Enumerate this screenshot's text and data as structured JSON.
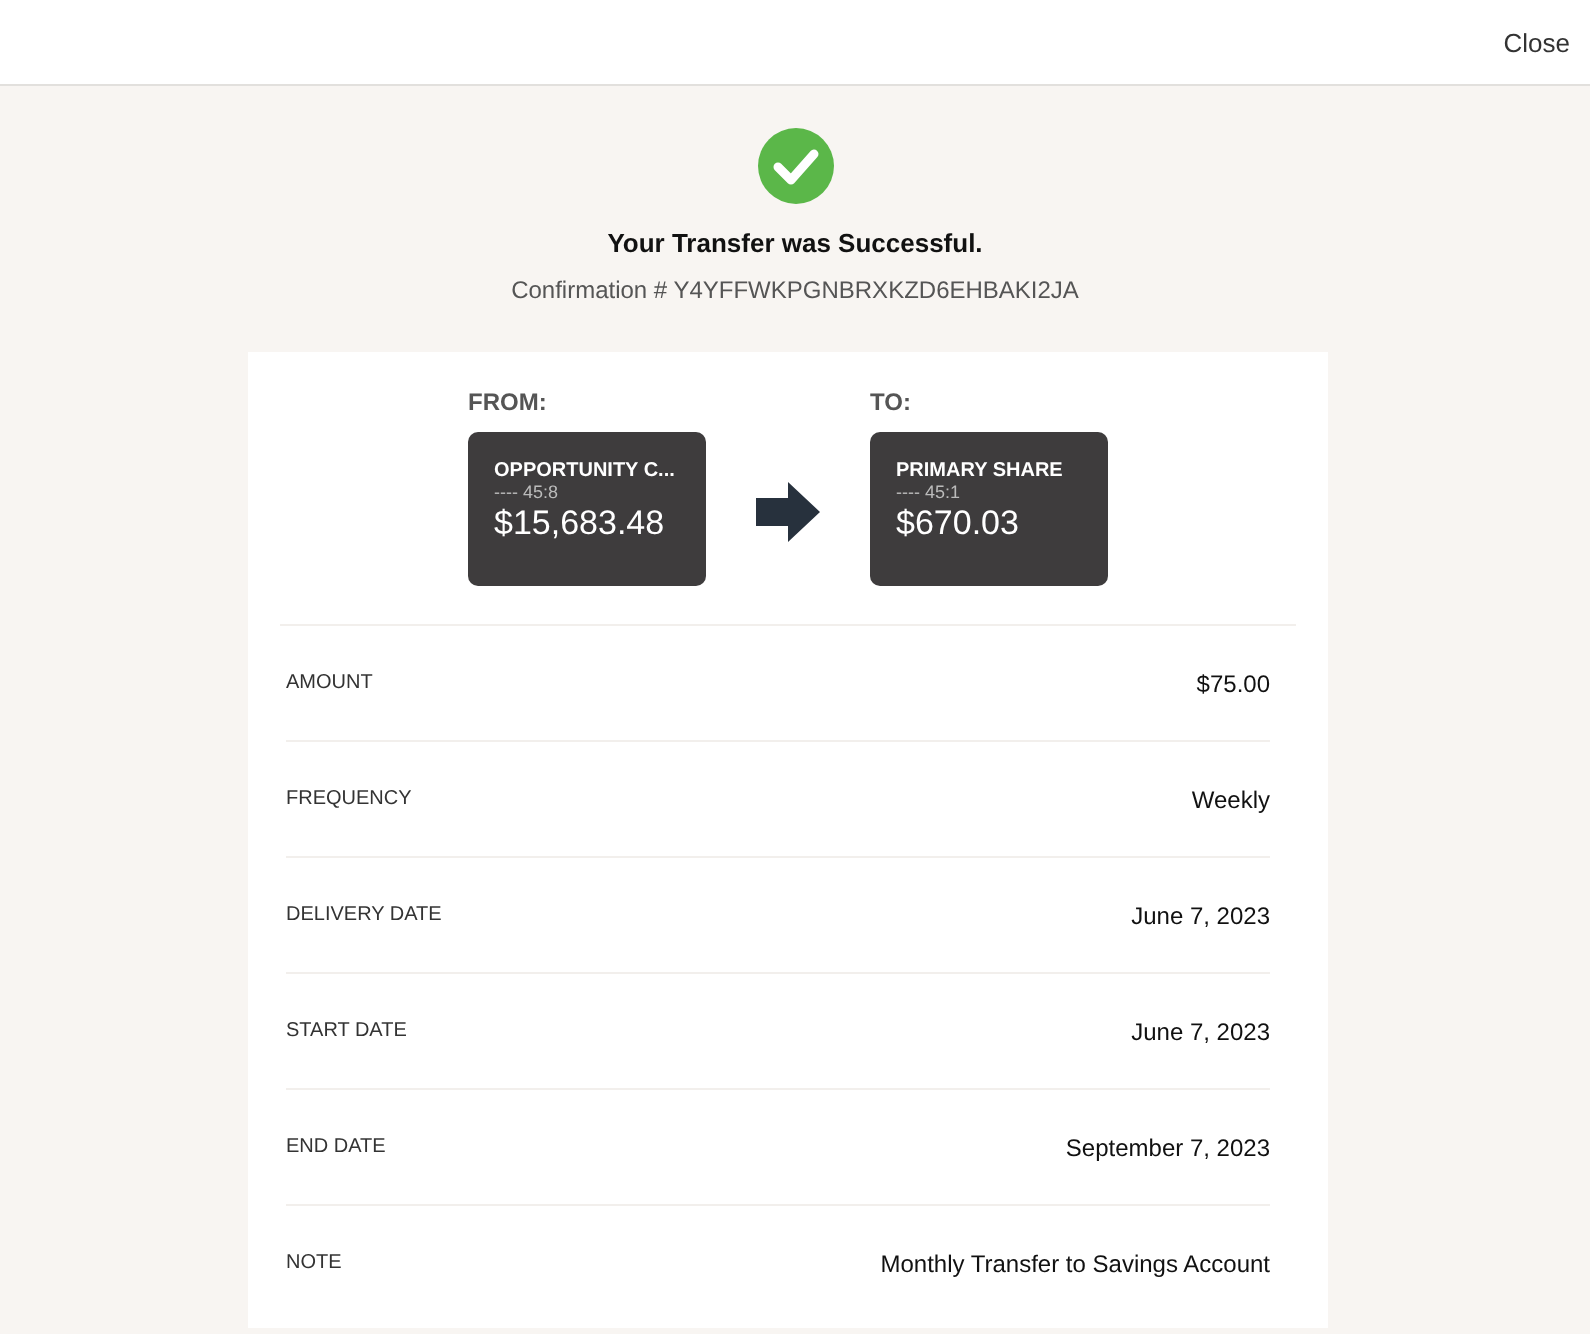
{
  "header": {
    "close": "Close"
  },
  "status": {
    "title": "Your Transfer was Successful.",
    "confirmation": "Confirmation # Y4YFFWKPGNBRXKZD6EHBAKI2JA"
  },
  "from": {
    "label": "FROM:",
    "name": "OPPORTUNITY C...",
    "number": "---- 45:8",
    "balance": "$15,683.48"
  },
  "to": {
    "label": "TO:",
    "name": "PRIMARY SHARE",
    "number": "---- 45:1",
    "balance": "$670.03"
  },
  "details": [
    {
      "label": "AMOUNT",
      "value": "$75.00"
    },
    {
      "label": "FREQUENCY",
      "value": "Weekly"
    },
    {
      "label": "DELIVERY DATE",
      "value": "June 7, 2023"
    },
    {
      "label": "START DATE",
      "value": "June 7, 2023"
    },
    {
      "label": "END DATE",
      "value": "September 7, 2023"
    },
    {
      "label": "NOTE",
      "value": "Monthly Transfer to Savings Account"
    }
  ]
}
